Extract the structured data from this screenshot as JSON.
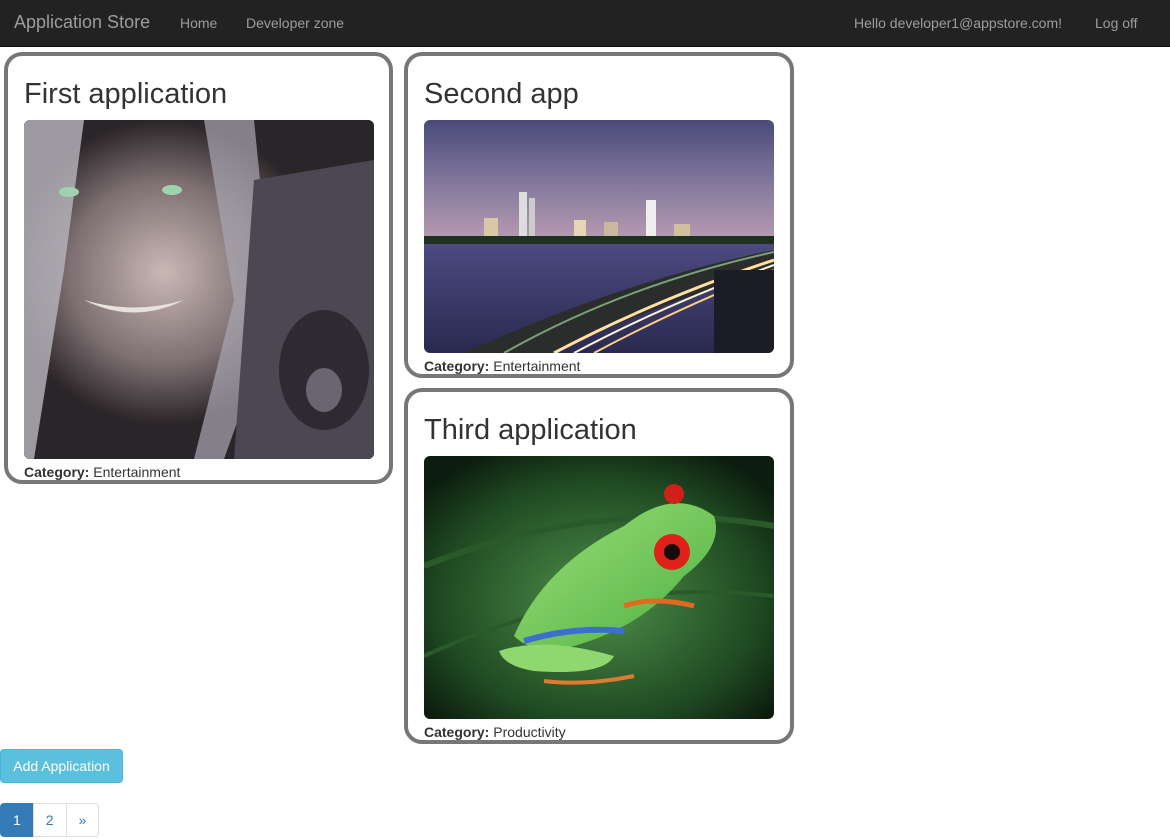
{
  "navbar": {
    "brand": "Application Store",
    "links": [
      {
        "label": "Home"
      },
      {
        "label": "Developer zone"
      }
    ],
    "greeting": "Hello developer1@appstore.com!",
    "logoff": "Log off",
    "background": "#222222"
  },
  "apps": [
    {
      "title": "First application",
      "category_label": "Category:",
      "category": "Entertainment",
      "image_icon": "warrior-portrait-image"
    },
    {
      "title": "Second app",
      "category_label": "Category:",
      "category": "Entertainment",
      "image_icon": "city-skyline-night-image"
    },
    {
      "title": "Third application",
      "category_label": "Category:",
      "category": "Productivity",
      "image_icon": "tree-frog-image"
    }
  ],
  "actions": {
    "add_label": "Add Application",
    "add_color": "#5bc0de"
  },
  "pagination": {
    "pages": [
      "1",
      "2"
    ],
    "current": "1",
    "next": "»",
    "accent": "#337ab7"
  }
}
